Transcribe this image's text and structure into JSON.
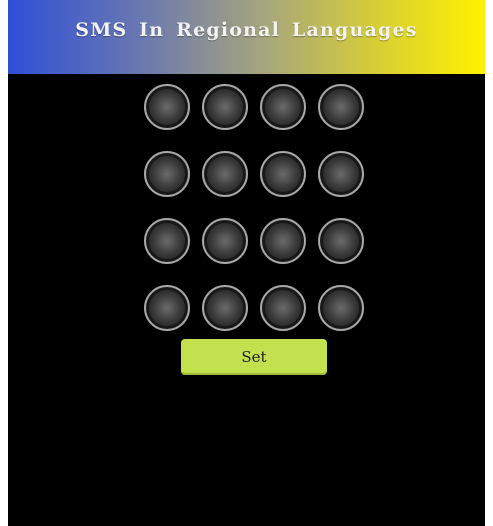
{
  "header": {
    "title": "SMS In Regional Languages",
    "gradient_colors": [
      "#2f4fd8",
      "#fff200"
    ]
  },
  "pattern_grid": {
    "rows": 4,
    "columns": 4,
    "dot_count": 16
  },
  "actions": {
    "set_label": "Set",
    "set_color": "#c3e04f"
  },
  "colors": {
    "background": "#000000"
  }
}
